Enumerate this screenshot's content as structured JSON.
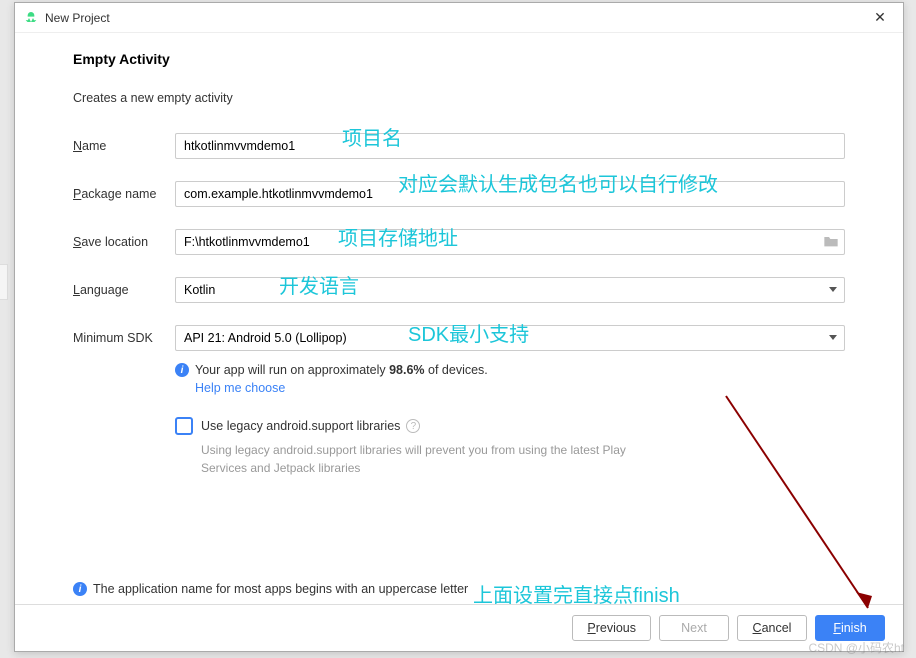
{
  "window": {
    "title": "New Project"
  },
  "header": {
    "title": "Empty Activity",
    "subtitle": "Creates a new empty activity"
  },
  "form": {
    "name": {
      "label_pre": "N",
      "label_post": "ame",
      "value": "htkotlinmvvmdemo1"
    },
    "package": {
      "label_pre": "P",
      "label_post": "ackage name",
      "value": "com.example.htkotlinmvvmdemo1"
    },
    "save": {
      "label_pre": "S",
      "label_post": "ave location",
      "value": "F:\\htkotlinmvvmdemo1"
    },
    "language": {
      "label_pre": "L",
      "label_post": "anguage",
      "value": "Kotlin"
    },
    "sdk": {
      "label": "Minimum SDK",
      "value": "API 21: Android 5.0 (Lollipop)"
    }
  },
  "info": {
    "runs_on_pre": "Your app will run on approximately ",
    "runs_on_pct": "98.6%",
    "runs_on_post": " of devices.",
    "help_link": "Help me choose"
  },
  "legacy": {
    "label": "Use legacy android.support libraries",
    "hint": "Using legacy android.support libraries will prevent you from using the latest Play Services and Jetpack libraries"
  },
  "footer_hint": "The application name for most apps begins with an uppercase letter",
  "buttons": {
    "previous_pre": "P",
    "previous_post": "revious",
    "next": "Next",
    "cancel_pre": "C",
    "cancel_post": "ancel",
    "finish_pre": "F",
    "finish_post": "inish"
  },
  "annotations": {
    "name": "项目名",
    "package": "对应会默认生成包名也可以自行修改",
    "save": "项目存储地址",
    "language": "开发语言",
    "sdk": "SDK最小支持",
    "finish": "上面设置完直接点finish"
  },
  "watermark": "CSDN @小码农ht"
}
